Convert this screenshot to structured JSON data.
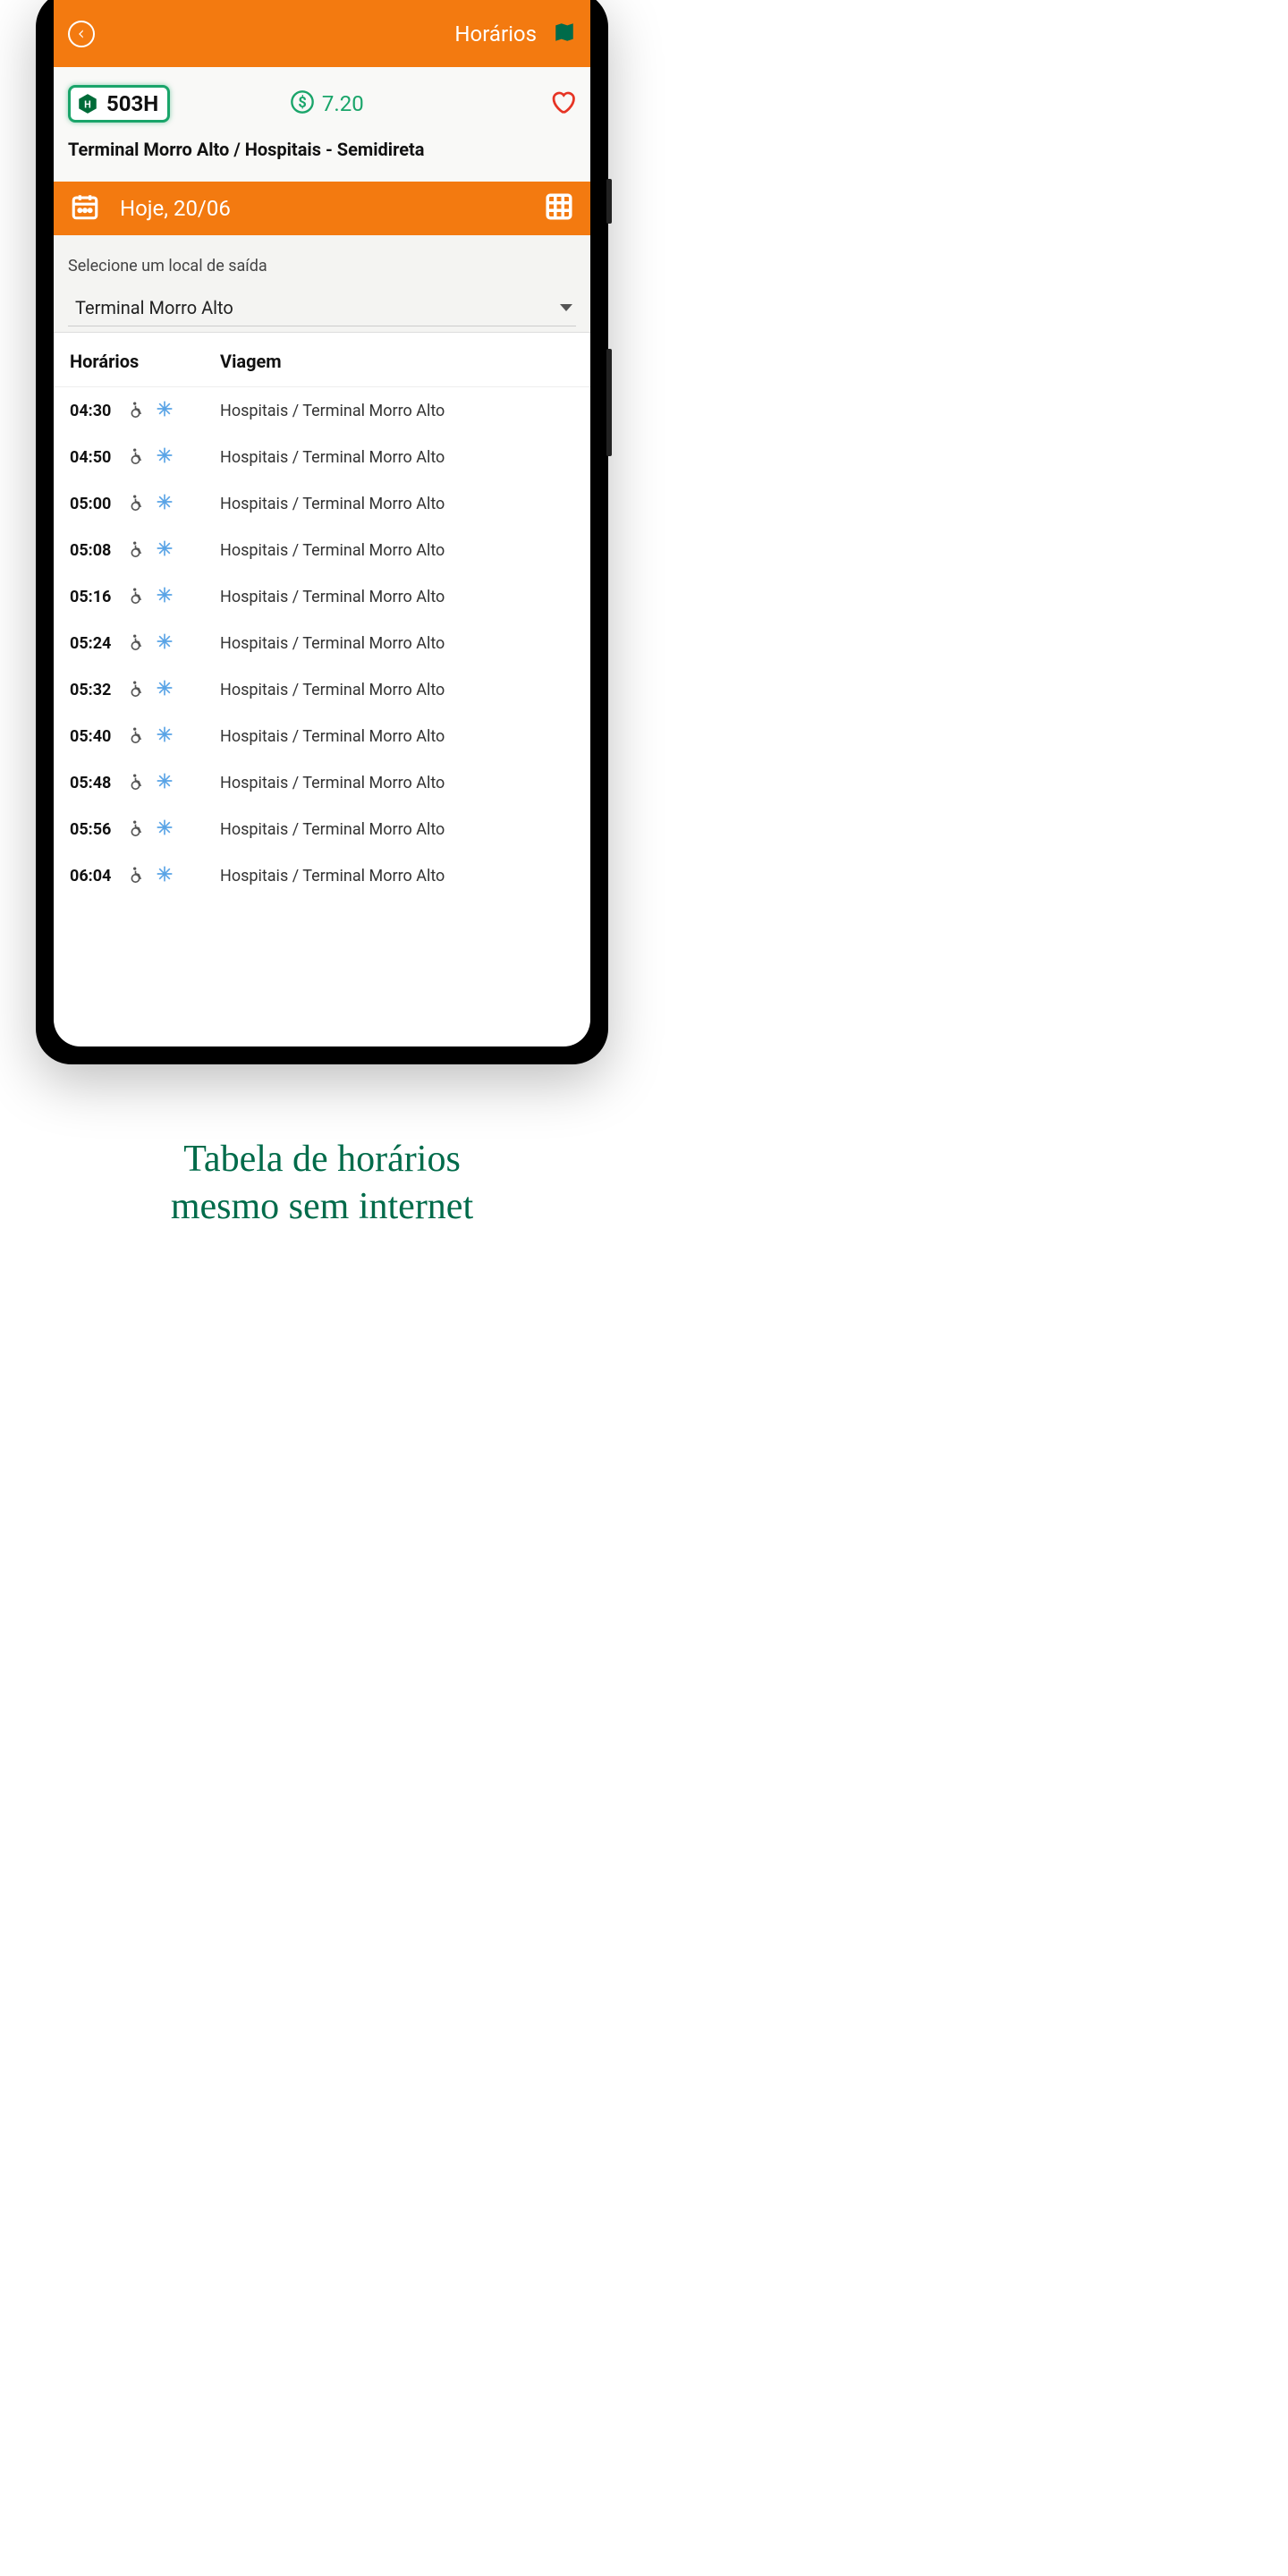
{
  "header": {
    "title": "Horários"
  },
  "route": {
    "code": "503H",
    "fare": "7.20",
    "name": "Terminal Morro Alto / Hospitais - Semidireta"
  },
  "dateBar": {
    "label": "Hoje, 20/06"
  },
  "select": {
    "label": "Selecione um local de saída",
    "value": "Terminal Morro Alto"
  },
  "table": {
    "timeHeader": "Horários",
    "tripHeader": "Viagem"
  },
  "rows": [
    {
      "time": "04:30",
      "trip": "Hospitais / Terminal Morro Alto"
    },
    {
      "time": "04:50",
      "trip": "Hospitais / Terminal Morro Alto"
    },
    {
      "time": "05:00",
      "trip": "Hospitais / Terminal Morro Alto"
    },
    {
      "time": "05:08",
      "trip": "Hospitais / Terminal Morro Alto"
    },
    {
      "time": "05:16",
      "trip": "Hospitais / Terminal Morro Alto"
    },
    {
      "time": "05:24",
      "trip": "Hospitais / Terminal Morro Alto"
    },
    {
      "time": "05:32",
      "trip": "Hospitais / Terminal Morro Alto"
    },
    {
      "time": "05:40",
      "trip": "Hospitais / Terminal Morro Alto"
    },
    {
      "time": "05:48",
      "trip": "Hospitais / Terminal Morro Alto"
    },
    {
      "time": "05:56",
      "trip": "Hospitais / Terminal Morro Alto"
    },
    {
      "time": "06:04",
      "trip": "Hospitais / Terminal Morro Alto"
    }
  ],
  "promo": {
    "line1": "Tabela de horários",
    "line2": "mesmo sem internet"
  }
}
